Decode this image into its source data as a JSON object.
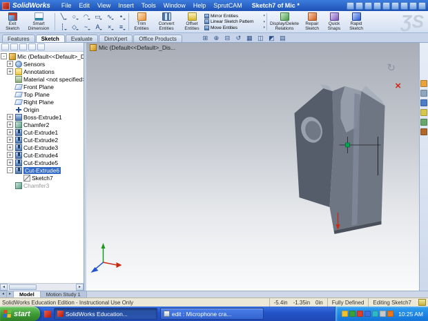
{
  "colors": {
    "titlebar_blue": "#2a60cf",
    "selection_blue": "#316ac5",
    "taskbar_blue": "#2a5ade",
    "start_green": "#3d9a34",
    "status_bg": "#ece9d8",
    "viewport_top": "#a9aeb8",
    "model_gray": "#6e7684",
    "sketch_point_green": "#00a550",
    "arrow_red": "#cc2a10"
  },
  "titlebar": {
    "app": "SolidWorks",
    "menus": [
      "File",
      "Edit",
      "View",
      "Insert",
      "Tools",
      "Window",
      "Help",
      "SprutCAM"
    ],
    "doc": "Sketch7 of Mic *"
  },
  "toolbar": {
    "exit_sketch": "Exit Sketch",
    "smart_dimension": "Smart Dimension",
    "trim": "Trim Entities",
    "convert": "Convert Entities",
    "offset": "Offset Entities",
    "mirror": "Mirror Entities",
    "linear_pattern": "Linear Sketch Pattern",
    "move": "Move Entities",
    "relations": "Display/Delete Relations",
    "repair": "Repair Sketch",
    "quick_snaps": "Quick Snaps",
    "rapid": "Rapid Sketch",
    "watermark": "ƷS"
  },
  "icons": {
    "grid": [
      "╲",
      "○",
      "◠",
      "▭",
      "∿",
      "•",
      "┆",
      "◇",
      "~",
      "A",
      "×",
      "≡"
    ],
    "hud": [
      "⊞",
      "⊕",
      "⊟",
      "↺",
      "▦",
      "◫",
      "◩",
      "▤"
    ],
    "confirm": "↻",
    "cancel": "×",
    "scroll_left": "◂",
    "scroll_right": "▸"
  },
  "tabs": [
    "Features",
    "Sketch",
    "Evaluate",
    "DimXpert",
    "Office Products"
  ],
  "viewport": {
    "breadcrumb": "Mic (Default<<Default>_Dis..."
  },
  "tree": {
    "items": [
      {
        "exp": "-",
        "label": "Mic (Default<<Default>_Display St"
      },
      {
        "exp": "+",
        "label": "Sensors"
      },
      {
        "exp": "+",
        "label": "Annotations"
      },
      {
        "exp": "",
        "label": "Material <not specified>"
      },
      {
        "exp": "",
        "label": "Front Plane"
      },
      {
        "exp": "",
        "label": "Top Plane"
      },
      {
        "exp": "",
        "label": "Right Plane"
      },
      {
        "exp": "",
        "label": "Origin"
      },
      {
        "exp": "+",
        "label": "Boss-Extrude1"
      },
      {
        "exp": "+",
        "label": "Chamfer2"
      },
      {
        "exp": "+",
        "label": "Cut-Extrude1"
      },
      {
        "exp": "+",
        "label": "Cut-Extrude2"
      },
      {
        "exp": "+",
        "label": "Cut-Extrude3"
      },
      {
        "exp": "+",
        "label": "Cut-Extrude4"
      },
      {
        "exp": "+",
        "label": "Cut-Extrude5"
      },
      {
        "exp": "-",
        "label": "Cut-Extrude6"
      },
      {
        "exp": "",
        "label": "Sketch7"
      },
      {
        "exp": "",
        "label": "Chamfer3"
      }
    ]
  },
  "doc_tabs": [
    "Model",
    "Motion Study 1"
  ],
  "status": {
    "message": "SolidWorks Education Edition - Instructional Use Only",
    "coord_x": "-5.4in",
    "coord_y": "-1.35in",
    "coord_z": "0in",
    "state": "Fully Defined",
    "mode": "Editing Sketch7"
  },
  "taskbar": {
    "start": "start",
    "tasks": [
      "SolidWorks Education...",
      "edit : Microphone cra..."
    ],
    "time": "10:25 AM"
  }
}
